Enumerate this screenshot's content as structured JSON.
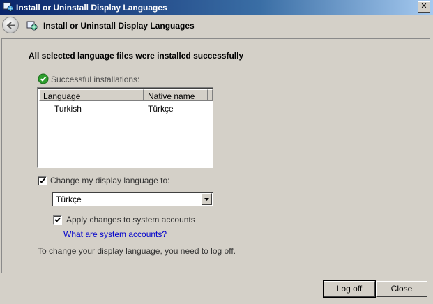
{
  "window": {
    "title": "Install or Uninstall Display Languages",
    "close_glyph": "✕"
  },
  "navbar": {
    "title": "Install or Uninstall Display Languages"
  },
  "main": {
    "heading": "All selected language files were installed successfully",
    "success_label": "Successful installations:",
    "list": {
      "columns": [
        "Language",
        "Native name"
      ],
      "rows": [
        {
          "language": "Turkish",
          "native": "Türkçe"
        }
      ]
    },
    "change_display_language": {
      "label": "Change my display language to:",
      "checked": true
    },
    "language_select": {
      "value": "Türkçe"
    },
    "apply_system_accounts": {
      "label": "Apply changes to system accounts",
      "checked": true
    },
    "link": "What are system accounts?",
    "note": "To change your display language, you need to log off."
  },
  "footer": {
    "logoff_label": "Log off",
    "close_label": "Close"
  },
  "colors": {
    "titlebar_start": "#0a246a",
    "link": "#0000cc",
    "success": "#2e9e2e",
    "dialog_bg": "#d4d0c8"
  }
}
